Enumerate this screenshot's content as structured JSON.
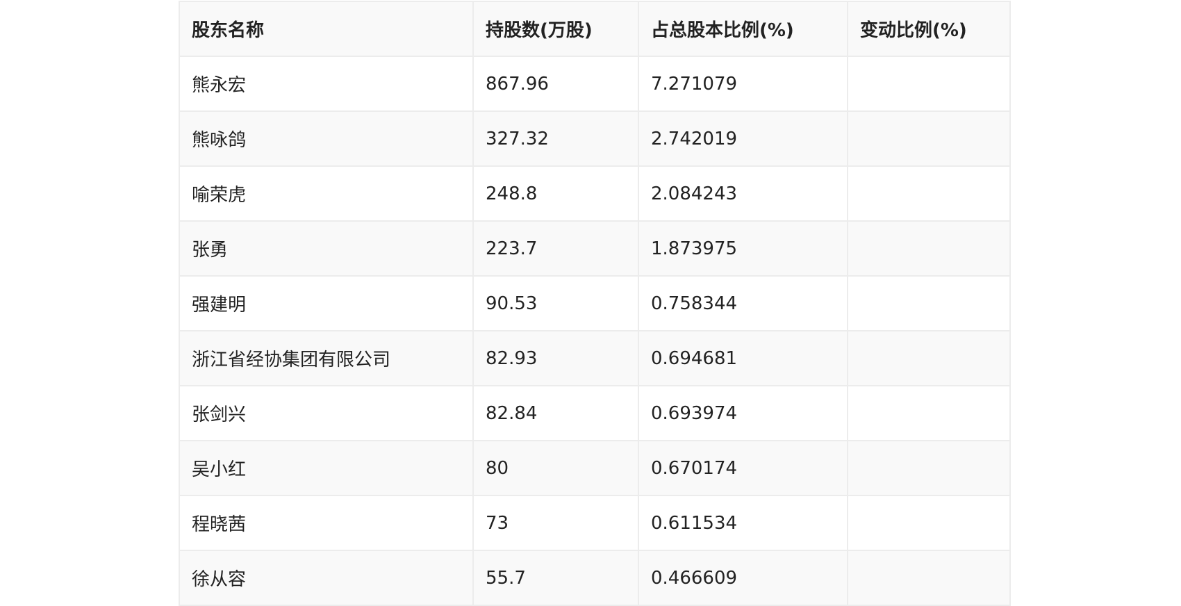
{
  "table": {
    "headers": [
      "股东名称",
      "持股数(万股)",
      "占总股本比例(%)",
      "变动比例(%)"
    ],
    "rows": [
      [
        "熊永宏",
        "867.96",
        "7.271079",
        ""
      ],
      [
        "熊咏鸽",
        "327.32",
        "2.742019",
        ""
      ],
      [
        "喻荣虎",
        "248.8",
        "2.084243",
        ""
      ],
      [
        "张勇",
        "223.7",
        "1.873975",
        ""
      ],
      [
        "强建明",
        "90.53",
        "0.758344",
        ""
      ],
      [
        "浙江省经协集团有限公司",
        "82.93",
        "0.694681",
        ""
      ],
      [
        "张剑兴",
        "82.84",
        "0.693974",
        ""
      ],
      [
        "吴小红",
        "80",
        "0.670174",
        ""
      ],
      [
        "程晓茜",
        "73",
        "0.611534",
        ""
      ],
      [
        "徐从容",
        "55.7",
        "0.466609",
        ""
      ]
    ]
  }
}
